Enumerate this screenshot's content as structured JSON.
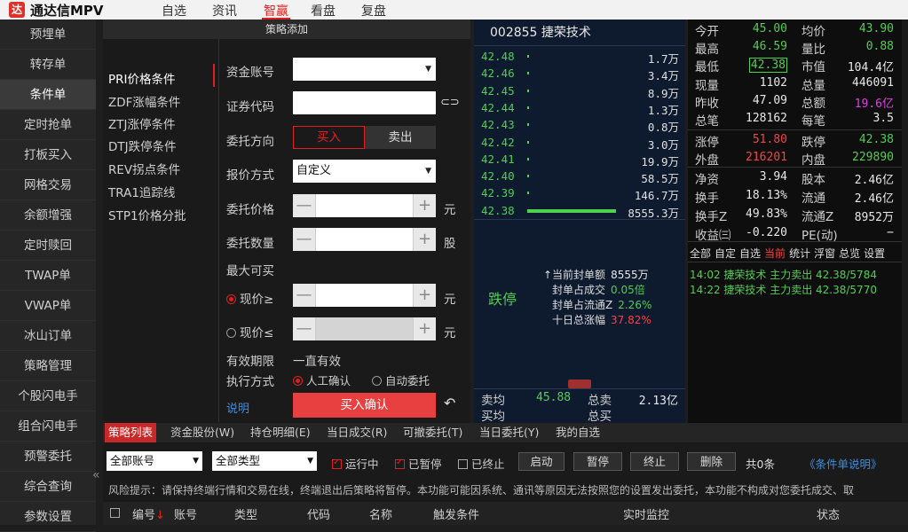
{
  "app": {
    "logo_text": "达",
    "title": "通达信MPV"
  },
  "nav": [
    {
      "label": "自选"
    },
    {
      "label": "资讯"
    },
    {
      "label": "智赢"
    },
    {
      "label": "看盘"
    },
    {
      "label": "复盘"
    }
  ],
  "sidebar": {
    "items": [
      {
        "label": "预埋单"
      },
      {
        "label": "转存单"
      },
      {
        "label": "条件单"
      },
      {
        "label": "定时抢单"
      },
      {
        "label": "打板买入"
      },
      {
        "label": "网格交易"
      },
      {
        "label": "余额增强"
      },
      {
        "label": "定时赎回"
      },
      {
        "label": "TWAP单"
      },
      {
        "label": "VWAP单"
      },
      {
        "label": "冰山订单"
      },
      {
        "label": "策略管理"
      },
      {
        "label": "个股闪电手"
      },
      {
        "label": "组合闪电手"
      },
      {
        "label": "预警委托"
      },
      {
        "label": "综合查询"
      },
      {
        "label": "参数设置"
      }
    ],
    "collapse_glyph": "«"
  },
  "strategy": {
    "title": "策略添加",
    "conditions": [
      {
        "label": "PRI价格条件"
      },
      {
        "label": "ZDF涨幅条件"
      },
      {
        "label": "ZTJ涨停条件"
      },
      {
        "label": "DTJ跌停条件"
      },
      {
        "label": "REV拐点条件"
      },
      {
        "label": "TRA1追踪线"
      },
      {
        "label": "STP1价格分批"
      }
    ],
    "form": {
      "account_label": "资金账号",
      "account_value": "",
      "code_label": "证券代码",
      "code_value": "",
      "direction_label": "委托方向",
      "buy_label": "买入",
      "sell_label": "卖出",
      "price_type_label": "报价方式",
      "price_type_value": "自定义",
      "price_label": "委托价格",
      "price_unit": "元",
      "qty_label": "委托数量",
      "qty_unit": "股",
      "max_buy_label": "最大可买",
      "max_buy_value": "",
      "current_ge_label": "现价≥",
      "current_ge_unit": "元",
      "current_le_label": "现价≤",
      "current_le_unit": "元",
      "validity_label": "有效期限",
      "validity_value": "一直有效",
      "exec_label": "执行方式",
      "exec_manual": "人工确认",
      "exec_auto": "自动委托",
      "explain_link": "说明",
      "confirm_button": "买入确认",
      "minus_glyph": "—",
      "plus_glyph": "+",
      "link_icon_glyph": "⊂⊃",
      "undo_glyph": "↶"
    }
  },
  "orderbook": {
    "title": "002855 捷荣技术",
    "rows": [
      {
        "price": "42.48",
        "volume": "1.7万"
      },
      {
        "price": "42.46",
        "volume": "3.4万"
      },
      {
        "price": "42.45",
        "volume": "8.9万"
      },
      {
        "price": "42.44",
        "volume": "1.3万"
      },
      {
        "price": "42.43",
        "volume": "0.8万"
      },
      {
        "price": "42.42",
        "volume": "3.0万"
      },
      {
        "price": "42.41",
        "volume": "19.9万"
      },
      {
        "price": "42.40",
        "volume": "58.5万"
      },
      {
        "price": "42.39",
        "volume": "146.7万"
      },
      {
        "price": "42.38",
        "volume": "8555.3万"
      }
    ],
    "limit_label": "跌停",
    "limit_info": [
      {
        "label": "↑当前封单额",
        "value": "8555万",
        "color": "#e8e8e8"
      },
      {
        "label": "封单占成交",
        "value": "0.05倍",
        "color": "#4fd04f"
      },
      {
        "label": "封单占流通Z",
        "value": "2.26%",
        "color": "#4fd04f"
      },
      {
        "label": "十日总涨幅",
        "value": "37.82%",
        "color": "#ff4040"
      }
    ],
    "sell_avg_label": "卖均",
    "sell_avg_value": "45.88",
    "buy_avg_label": "买均",
    "total_sell_label": "总卖",
    "total_sell_value": "2.13亿",
    "total_buy_label": "总买"
  },
  "quote": {
    "rows": [
      [
        {
          "label": "今开",
          "value": "45.00",
          "color": "g"
        },
        {
          "label": "均价",
          "value": "43.90",
          "color": "g"
        }
      ],
      [
        {
          "label": "最高",
          "value": "46.59",
          "color": "g"
        },
        {
          "label": "量比",
          "value": "0.88",
          "color": "g"
        }
      ],
      [
        {
          "label": "最低",
          "value": "42.38",
          "color": "g"
        },
        {
          "label": "市值",
          "value": "104.4亿",
          "color": "w"
        }
      ],
      [
        {
          "label": "现量",
          "value": "1102",
          "color": "w"
        },
        {
          "label": "总量",
          "value": "446091",
          "color": "w"
        }
      ],
      [
        {
          "label": "昨收",
          "value": "47.09",
          "color": "w"
        },
        {
          "label": "总额",
          "value": "19.6亿",
          "color": "m"
        }
      ],
      [
        {
          "label": "总笔",
          "value": "128162",
          "color": "w"
        },
        {
          "label": "每笔",
          "value": "3.5",
          "color": "w"
        }
      ],
      [
        {
          "label": "涨停",
          "value": "51.80",
          "color": "r"
        },
        {
          "label": "跌停",
          "value": "42.38",
          "color": "g"
        }
      ],
      [
        {
          "label": "外盘",
          "value": "216201",
          "color": "r"
        },
        {
          "label": "内盘",
          "value": "229890",
          "color": "g"
        }
      ],
      [
        {
          "label": "净资",
          "value": "3.94",
          "color": "w"
        },
        {
          "label": "股本",
          "value": "2.46亿",
          "color": "w"
        }
      ],
      [
        {
          "label": "换手",
          "value": "18.13%",
          "color": "w"
        },
        {
          "label": "流通",
          "value": "2.46亿",
          "color": "w"
        }
      ],
      [
        {
          "label": "换手Z",
          "value": "49.83%",
          "color": "w"
        },
        {
          "label": "流通Z",
          "value": "8952万",
          "color": "w"
        }
      ],
      [
        {
          "label": "收益㈢",
          "value": "-0.220",
          "color": "w"
        },
        {
          "label": "PE(动)",
          "value": "−",
          "color": "w"
        }
      ]
    ],
    "tabs": [
      {
        "label": "全部"
      },
      {
        "label": "自定"
      },
      {
        "label": "自选"
      },
      {
        "label": "当前"
      },
      {
        "label": "统计"
      },
      {
        "label": "浮窗"
      },
      {
        "label": "总览"
      },
      {
        "label": "设置"
      }
    ],
    "ticks": [
      {
        "text": "14:02 捷荣技术 主力卖出  42.38/5784"
      },
      {
        "text": "14:22 捷荣技术 主力卖出  42.38/5770"
      }
    ]
  },
  "bottom": {
    "tabs": [
      {
        "label": "策略列表"
      },
      {
        "label": "资金股份(W)"
      },
      {
        "label": "持仓明细(E)"
      },
      {
        "label": "当日成交(R)"
      },
      {
        "label": "可撤委托(T)"
      },
      {
        "label": "当日委托(Y)"
      },
      {
        "label": "我的自选"
      }
    ],
    "account_filter": "全部账号",
    "type_filter": "全部类型",
    "checks": [
      {
        "label": "运行中"
      },
      {
        "label": "已暂停"
      },
      {
        "label": "已终止"
      }
    ],
    "buttons": [
      {
        "label": "启动"
      },
      {
        "label": "暂停"
      },
      {
        "label": "终止"
      },
      {
        "label": "删除"
      }
    ],
    "count": "共0条",
    "help_link": "《条件单说明》",
    "risk_text": "风险提示：请保持终端行情和交易在线，终端退出后策略将暂停。本功能可能因系统、通讯等原因无法按照您的设置发出委托，本功能不构成对您委托成交、取",
    "columns": [
      {
        "label": "编号"
      },
      {
        "label": "账号"
      },
      {
        "label": "类型"
      },
      {
        "label": "代码"
      },
      {
        "label": "名称"
      },
      {
        "label": "触发条件"
      },
      {
        "label": "实时监控"
      },
      {
        "label": "状态"
      }
    ],
    "sort_arrow": "↓"
  },
  "colors": {
    "accent": "#e02020",
    "up": "#ff4040",
    "down": "#4fd04f",
    "link": "#3d8ee0"
  }
}
